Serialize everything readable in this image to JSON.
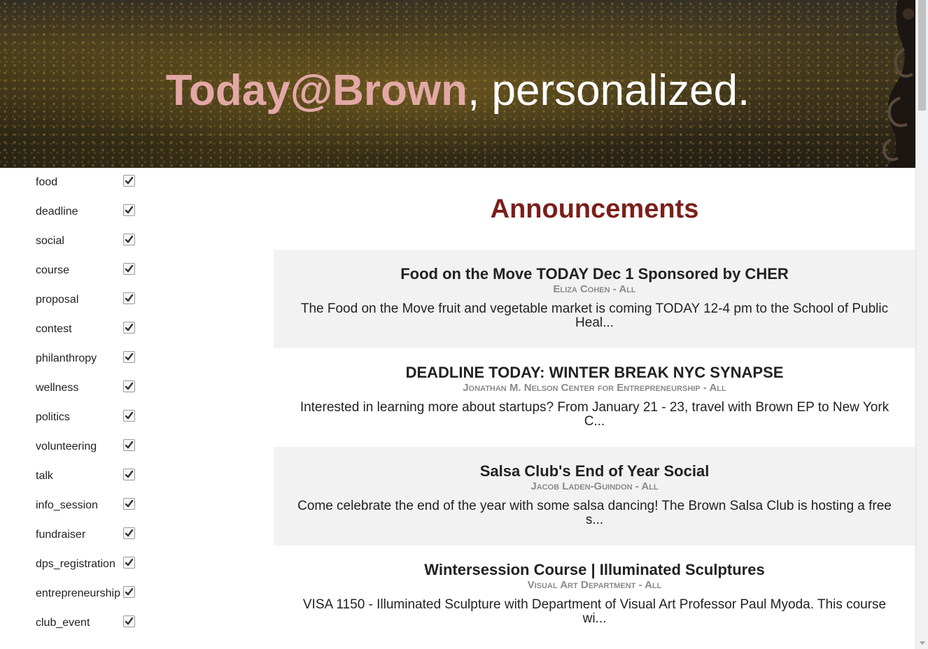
{
  "hero": {
    "brand": "Today@Brown",
    "tagline": ", personalized."
  },
  "filters": [
    {
      "label": "food",
      "checked": true
    },
    {
      "label": "deadline",
      "checked": true
    },
    {
      "label": "social",
      "checked": true
    },
    {
      "label": "course",
      "checked": true
    },
    {
      "label": "proposal",
      "checked": true
    },
    {
      "label": "contest",
      "checked": true
    },
    {
      "label": "philanthropy",
      "checked": true
    },
    {
      "label": "wellness",
      "checked": true
    },
    {
      "label": "politics",
      "checked": true
    },
    {
      "label": "volunteering",
      "checked": true
    },
    {
      "label": "talk",
      "checked": true
    },
    {
      "label": "info_session",
      "checked": true
    },
    {
      "label": "fundraiser",
      "checked": true
    },
    {
      "label": "dps_registration",
      "checked": true
    },
    {
      "label": "entrepreneurship",
      "checked": true
    },
    {
      "label": "club_event",
      "checked": true
    }
  ],
  "main": {
    "title": "Announcements",
    "announcements": [
      {
        "title": "Food on the Move TODAY Dec 1 Sponsored by CHER",
        "author": "Eliza Cohen - All",
        "description": "The Food on the Move fruit and vegetable market is coming TODAY 12-4 pm to the School of Public Heal..."
      },
      {
        "title": "DEADLINE TODAY: WINTER BREAK NYC SYNAPSE",
        "author": "Jonathan M. Nelson Center for Entrepreneurship - All",
        "description": "Interested in learning more about startups? From January 21 - 23, travel with Brown EP to New York C..."
      },
      {
        "title": "Salsa Club's End of Year Social",
        "author": "Jacob Laden-Guindon - All",
        "description": "Come celebrate the end of the year with some salsa dancing! The Brown Salsa Club is hosting a free s..."
      },
      {
        "title": "Wintersession Course | Illuminated Sculptures",
        "author": "Visual Art Department - All",
        "description": "VISA 1150 - Illuminated Sculpture with Department of Visual Art Professor Paul Myoda. This course wi..."
      }
    ]
  },
  "colors": {
    "brand": "#e3a8a6",
    "heading": "#7b1f1a",
    "card_shade": "#f2f2f2",
    "author": "#8a8a8a"
  }
}
